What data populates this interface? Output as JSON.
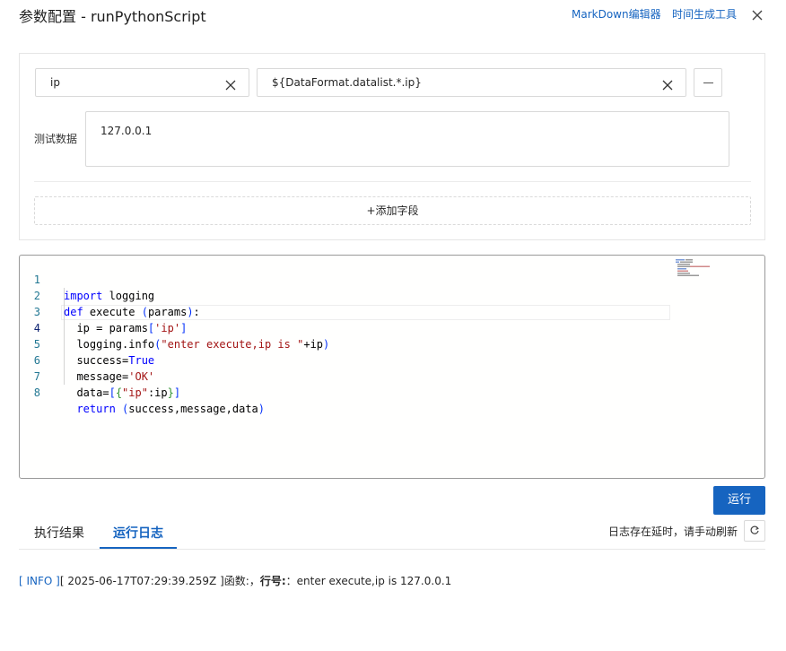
{
  "header": {
    "title": "参数配置 - runPythonScript",
    "links": [
      "MarkDown编辑器",
      "时间生成工具"
    ]
  },
  "params": {
    "field_name": "ip",
    "field_value": "${DataFormat.datalist.*.ip}",
    "test_data_label": "测试数据",
    "test_data_value": "127.0.0.1",
    "add_field_label": "+添加字段"
  },
  "editor": {
    "lines": [
      {
        "n": "1",
        "code": "import logging"
      },
      {
        "n": "2",
        "code": "def execute (params):"
      },
      {
        "n": "3",
        "code": "  ip = params['ip']"
      },
      {
        "n": "4",
        "code": "  logging.info(\"enter execute,ip is \"+ip)"
      },
      {
        "n": "5",
        "code": "  success=True"
      },
      {
        "n": "6",
        "code": "  message='OK'"
      },
      {
        "n": "7",
        "code": "  data=[{\"ip\":ip}]"
      },
      {
        "n": "8",
        "code": "  return (success,message,data)"
      }
    ]
  },
  "run_label": "运行",
  "tabs": [
    "执行结果",
    "运行日志"
  ],
  "active_tab": "运行日志",
  "refresh_hint": "日志存在延时，请手动刷新",
  "log": {
    "level": "[ INFO ]",
    "timestamp": "[ 2025-06-17T07:29:39.259Z ]",
    "func_label": "函数:",
    "sep": "，",
    "line_label": "行号:",
    "message": "：enter execute,ip is 127.0.0.1"
  },
  "colors": {
    "primary": "#1664c0",
    "keyword": "#0000ff",
    "string": "#a31515",
    "line_number": "#237893"
  }
}
